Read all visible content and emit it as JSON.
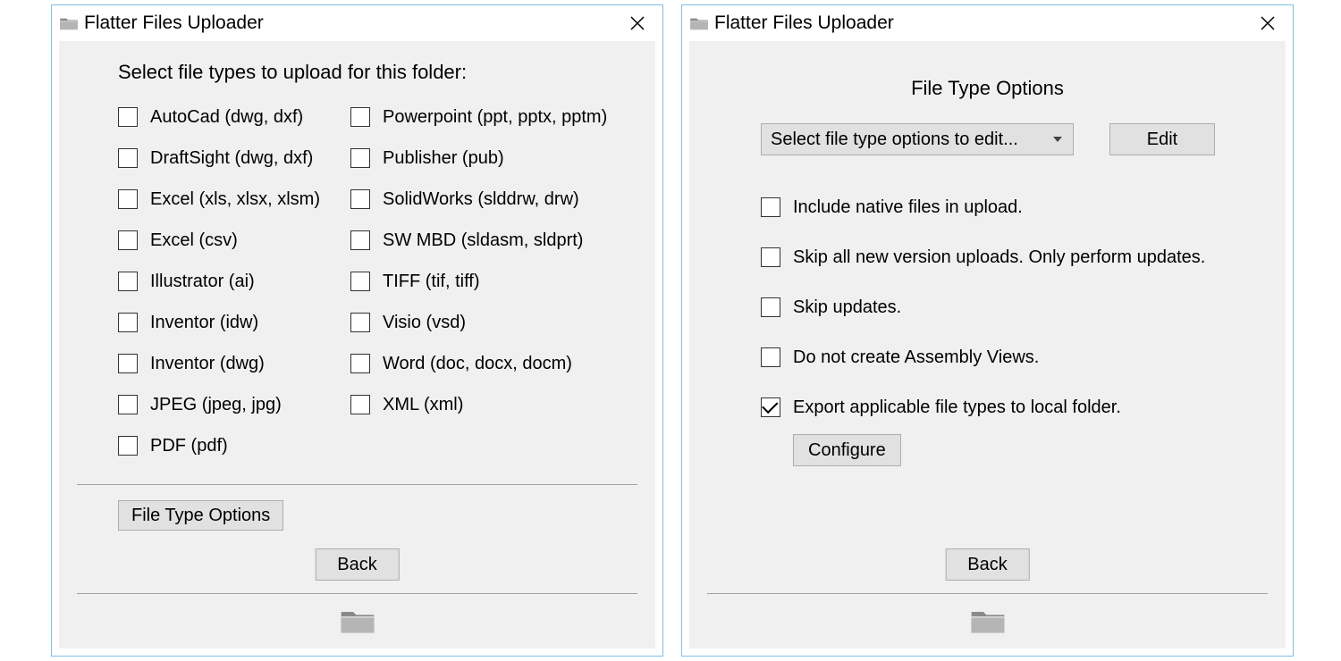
{
  "window": {
    "title": "Flatter Files Uploader"
  },
  "left": {
    "heading": "Select file types to upload for this folder:",
    "file_types_col1": [
      {
        "label": "AutoCad (dwg, dxf)",
        "checked": false
      },
      {
        "label": "DraftSight (dwg, dxf)",
        "checked": false
      },
      {
        "label": "Excel (xls, xlsx, xlsm)",
        "checked": false
      },
      {
        "label": "Excel (csv)",
        "checked": false
      },
      {
        "label": "Illustrator (ai)",
        "checked": false
      },
      {
        "label": "Inventor (idw)",
        "checked": false
      },
      {
        "label": "Inventor (dwg)",
        "checked": false
      },
      {
        "label": "JPEG (jpeg, jpg)",
        "checked": false
      },
      {
        "label": "PDF (pdf)",
        "checked": false
      }
    ],
    "file_types_col2": [
      {
        "label": "Powerpoint (ppt, pptx, pptm)",
        "checked": false
      },
      {
        "label": "Publisher (pub)",
        "checked": false
      },
      {
        "label": "SolidWorks (slddrw, drw)",
        "checked": false
      },
      {
        "label": "SW MBD (sldasm, sldprt)",
        "checked": false
      },
      {
        "label": "TIFF (tif, tiff)",
        "checked": false
      },
      {
        "label": "Visio (vsd)",
        "checked": false
      },
      {
        "label": "Word (doc, docx, docm)",
        "checked": false
      },
      {
        "label": "XML (xml)",
        "checked": false
      }
    ],
    "file_type_options_button": "File Type Options",
    "back_button": "Back"
  },
  "right": {
    "heading": "File Type Options",
    "dropdown_placeholder": "Select file type options to edit...",
    "edit_button": "Edit",
    "options": [
      {
        "label": "Include native files in upload.",
        "checked": false
      },
      {
        "label": "Skip all new version uploads. Only perform updates.",
        "checked": false
      },
      {
        "label": "Skip updates.",
        "checked": false
      },
      {
        "label": "Do not create Assembly Views.",
        "checked": false
      },
      {
        "label": "Export applicable file types to local folder.",
        "checked": true
      }
    ],
    "configure_button": "Configure",
    "back_button": "Back"
  }
}
